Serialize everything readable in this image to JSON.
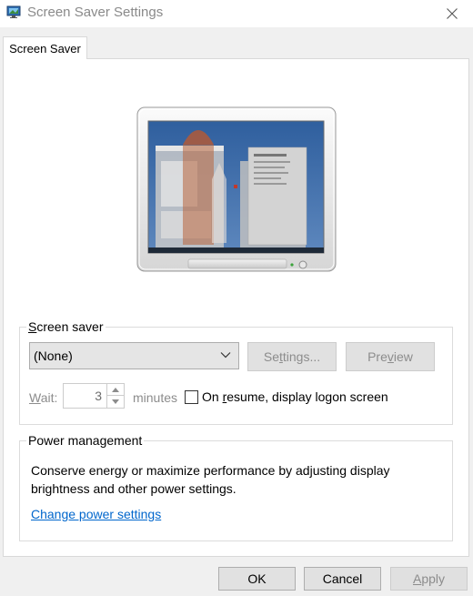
{
  "window": {
    "title": "Screen Saver Settings",
    "icon": "screen-saver-app-icon"
  },
  "tabs": [
    {
      "label": "Screen Saver",
      "selected": true
    }
  ],
  "preview_monitor": {
    "description_icon": "monitor-preview-image"
  },
  "screen_saver": {
    "group_label_prefix": "S",
    "group_label_rest": "creen saver",
    "selected_option": "(None)",
    "settings_prefix": "Se",
    "settings_u": "t",
    "settings_rest": "tings...",
    "preview_prefix": "Pre",
    "preview_u": "v",
    "preview_rest": "iew",
    "wait_u": "W",
    "wait_rest": "ait:",
    "wait_value": "3",
    "minutes_label": "minutes",
    "resume_prefix": "On ",
    "resume_u": "r",
    "resume_rest": "esume, display logon screen",
    "resume_checked": false
  },
  "power_management": {
    "group_label": "Power management",
    "description": "Conserve energy or maximize performance by adjusting display brightness and other power settings.",
    "link_label": "Change power settings"
  },
  "footer": {
    "ok_label": "OK",
    "cancel_label": "Cancel",
    "apply_prefix": "",
    "apply_u": "A",
    "apply_rest": "pply"
  },
  "colors": {
    "link": "#0066cc",
    "disabled_text": "#8c8c8c",
    "button_face": "#e1e1e1"
  }
}
